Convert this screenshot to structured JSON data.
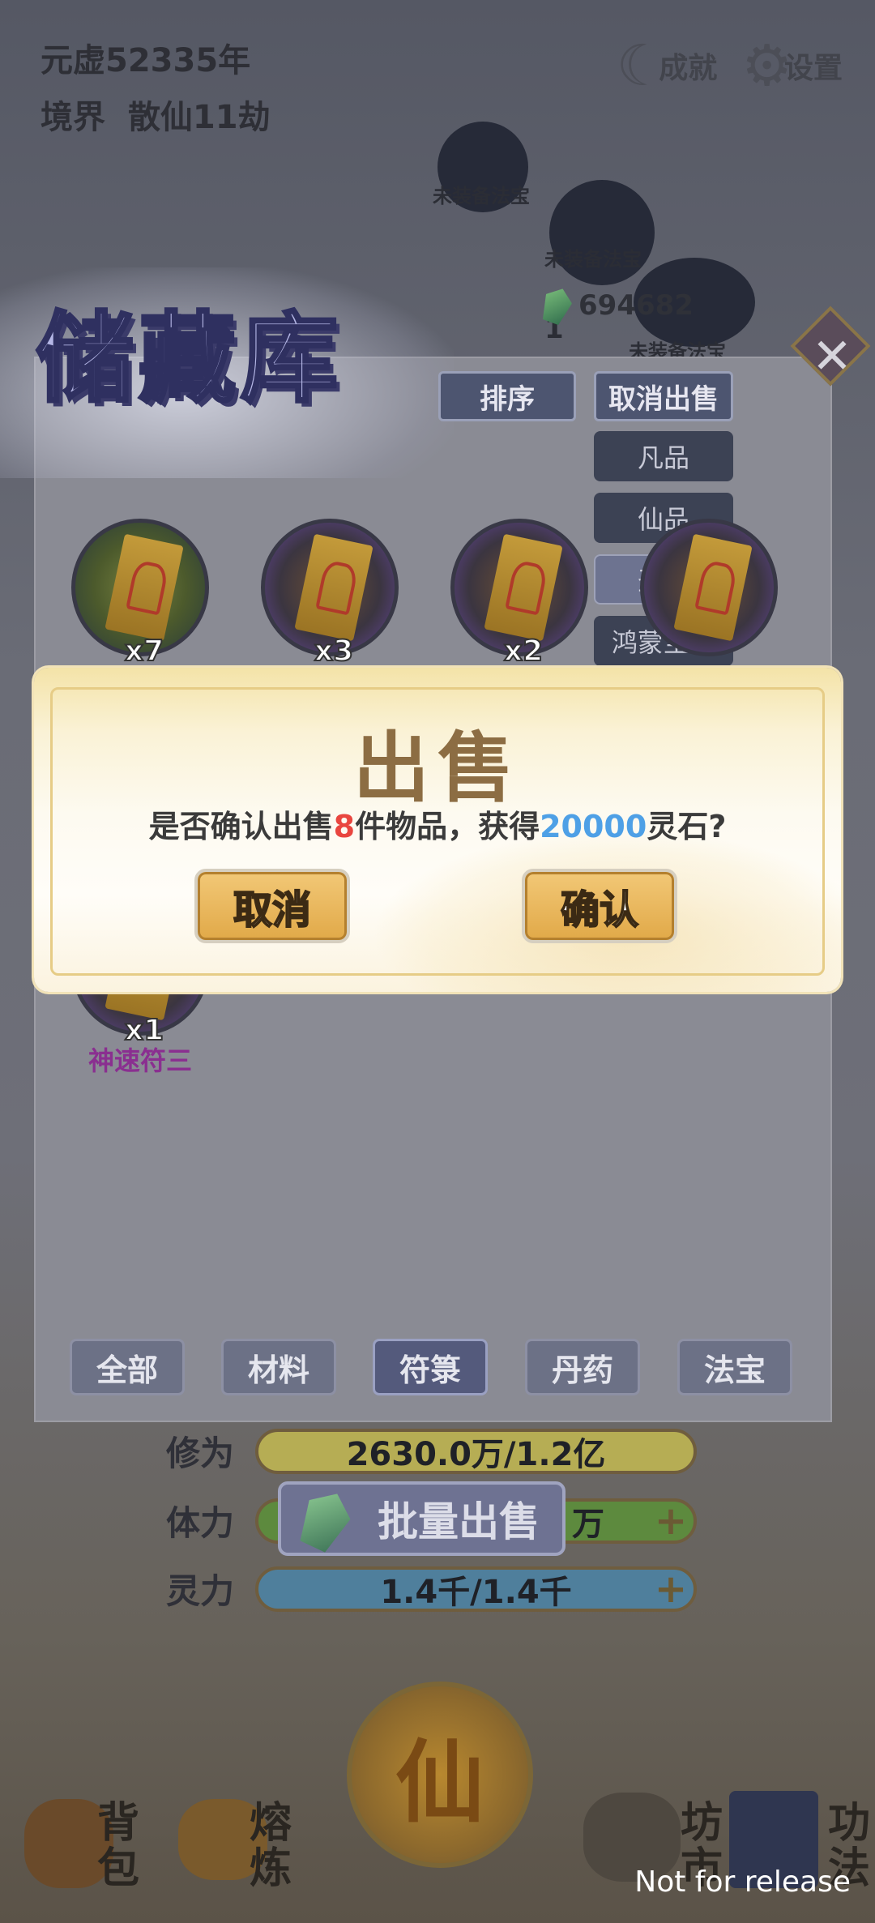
{
  "game": {
    "era": "元虚52335年",
    "realm_label": "境界",
    "realm_value": "散仙11劫",
    "achievements_label": "成就",
    "settings_label": "设置",
    "spirit_stones": "694682",
    "equip_level": "1",
    "unequipped_labels": [
      "未装备法宝",
      "未装备法宝",
      "未装备法宝"
    ]
  },
  "storage": {
    "title": "储藏库",
    "sort_label": "排序",
    "cancel_sell_label": "取消出售",
    "grades": [
      {
        "label": "凡品",
        "active": false
      },
      {
        "label": "仙品",
        "active": false
      },
      {
        "label": "圣物",
        "active": true
      },
      {
        "label": "鸿蒙至宝",
        "active": false
      }
    ],
    "items": [
      {
        "qty": "x7",
        "style": "green"
      },
      {
        "qty": "x3",
        "style": "gold"
      },
      {
        "qty": "x2",
        "style": "gold"
      },
      {
        "qty": "x1",
        "name": "神速符三",
        "style": "gold"
      }
    ],
    "tabs": [
      {
        "label": "全部",
        "active": false
      },
      {
        "label": "材料",
        "active": false
      },
      {
        "label": "符箓",
        "active": true
      },
      {
        "label": "丹药",
        "active": false
      },
      {
        "label": "法宝",
        "active": false
      }
    ],
    "batch_sell_label": "批量出售"
  },
  "stats": [
    {
      "label": "修为",
      "value": "2630.0万/1.2亿",
      "color": "#b6ad54",
      "plus": false
    },
    {
      "label": "体力",
      "value": "万",
      "color": "#5d8a3e",
      "plus": true
    },
    {
      "label": "灵力",
      "value": "1.4千/1.4千",
      "color": "#4f7f9c",
      "plus": true
    }
  ],
  "center_button": "仙",
  "bottom_nav": [
    {
      "top": "背",
      "bottom": "包"
    },
    {
      "top": "熔",
      "bottom": "炼"
    },
    {
      "top": "坊",
      "bottom": "市"
    },
    {
      "top": "功",
      "bottom": "法"
    }
  ],
  "sell_dialog": {
    "title": "出售",
    "msg_prefix": "是否确认出售",
    "count": "8",
    "msg_mid": "件物品，获得",
    "amount": "20000",
    "msg_suffix": "灵石?",
    "cancel_label": "取消",
    "confirm_label": "确认",
    "count_color": "#e9463f",
    "amount_color": "#4ea0e6"
  },
  "watermark": "Not for release"
}
